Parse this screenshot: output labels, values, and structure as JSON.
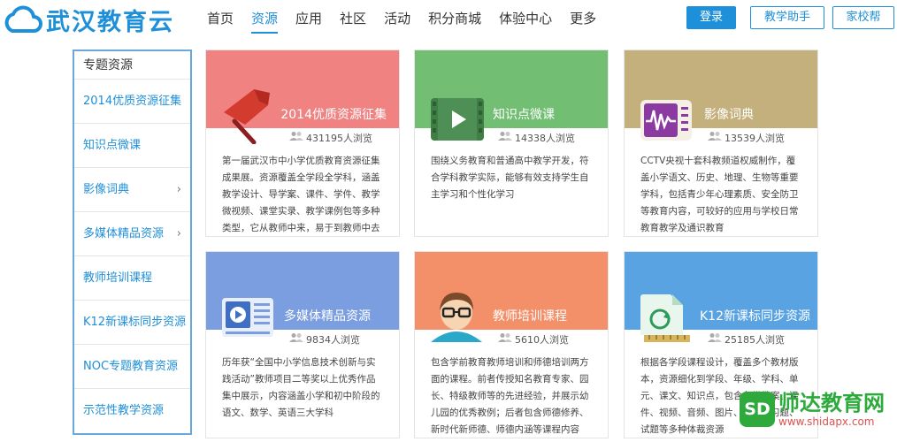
{
  "logo": {
    "text": "武汉教育云"
  },
  "nav": [
    "首页",
    "资源",
    "应用",
    "社区",
    "活动",
    "积分商城",
    "体验中心",
    "更多"
  ],
  "nav_active_index": 1,
  "buttons": {
    "login": "登录",
    "teach_helper": "教学助手",
    "home_school": "家校帮"
  },
  "sidebar": {
    "title": "专题资源",
    "items": [
      {
        "label": "2014优质资源征集",
        "chevron": ""
      },
      {
        "label": "知识点微课",
        "chevron": ""
      },
      {
        "label": "影像词典",
        "chevron": "›"
      },
      {
        "label": "多媒体精品资源",
        "chevron": "›"
      },
      {
        "label": "教师培训课程",
        "chevron": ""
      },
      {
        "label": "K12新课标同步资源",
        "chevron": ""
      },
      {
        "label": "NOC专题教育资源",
        "chevron": ""
      },
      {
        "label": "示范性教学资源",
        "chevron": ""
      }
    ]
  },
  "cards": [
    {
      "title": "2014优质资源征集",
      "views": "431195人浏览",
      "color": "#f08282",
      "icon": "flag-icon",
      "desc": "第一届武汉市中小学优质教育资源征集成果展。资源覆盖全学段全学科，涵盖教学设计、导学案、课件、学件、教学微视频、课堂实录、教学课例包等多种类型，它从教师中来，易于到教师中去"
    },
    {
      "title": "知识点微课",
      "views": "14338人浏览",
      "color": "#72bf74",
      "icon": "video-icon",
      "desc": "围绕义务教育和普通高中教学开发，符合学科教学实际，能够有效支持学生自主学习和个性化学习"
    },
    {
      "title": "影像词典",
      "views": "13539人浏览",
      "color": "#c4b07c",
      "icon": "waveform-icon",
      "desc": "CCTV央视十套科教频道权威制作，覆盖小学语文、历史、地理、生物等重要学科，包括青少年心理素质、安全防卫等教育内容，可较好的应用与学校日常教育教学及通识教育"
    },
    {
      "title": "多媒体精品资源",
      "views": "9834人浏览",
      "color": "#7b9ee0",
      "icon": "media-player-icon",
      "desc": "历年获“全国中小学信息技术创新与实践活动”教师项目二等奖以上优秀作品集中展示，内容涵盖小学和初中阶段的语文、数学、英语三大学科"
    },
    {
      "title": "教师培训课程",
      "views": "5610人浏览",
      "color": "#f49069",
      "icon": "teacher-avatar-icon",
      "desc": "包含学前教育教师培训和师德培训两方面的课程。前者传授知名教育专家、园长、特级教师等的先进经验，并展示幼儿园的优秀教例；后者包含师德修养、新时代新师德、师德内涵等课程内容"
    },
    {
      "title": "K12新课标同步资源",
      "views": "25185人浏览",
      "color": "#5aa3e2",
      "icon": "sync-book-icon",
      "desc": "根据各学段课程设计，覆盖多个教材版本，资源细化到学段、年级、学科、单元、课文、知识点，包含各类教案、课件、视频、音频、图片、动画、习题、试题等多种体裁资源"
    }
  ],
  "watermark": {
    "badge": "SD",
    "text": "师达教育网",
    "url": "www.shidapx.com"
  }
}
